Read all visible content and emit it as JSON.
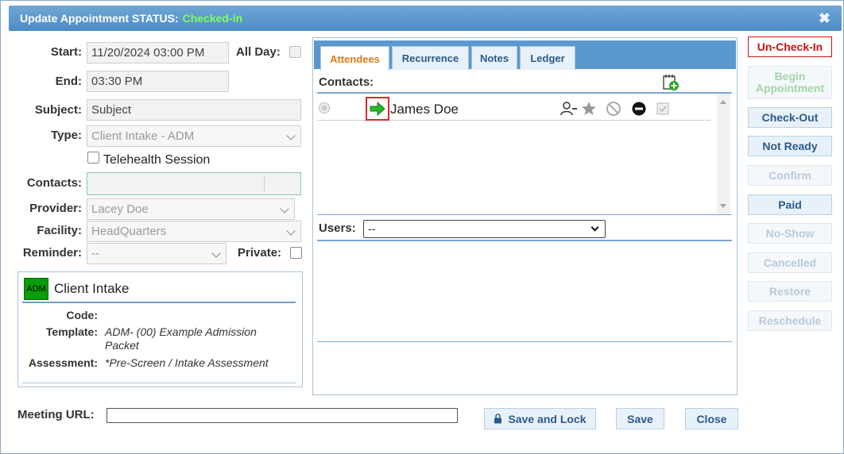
{
  "dialog": {
    "title": "Update Appointment STATUS:",
    "status": "Checked-in",
    "close_icon": "close-icon"
  },
  "form": {
    "start_label": "Start:",
    "start_value": "11/20/2024 03:00 PM",
    "all_day_label": "All Day:",
    "end_label": "End:",
    "end_value": "03:30 PM",
    "subject_label": "Subject:",
    "subject_value": "Subject",
    "type_label": "Type:",
    "type_value": "Client Intake - ADM",
    "telehealth_label": "Telehealth Session",
    "contacts_label": "Contacts:",
    "provider_label": "Provider:",
    "provider_value": "Lacey Doe",
    "facility_label": "Facility:",
    "facility_value": "HeadQuarters",
    "reminder_label": "Reminder:",
    "reminder_value": "--",
    "private_label": "Private:",
    "meeting_url_label": "Meeting URL:"
  },
  "service": {
    "badge": "ADM",
    "badge_color": "#0a9c0a",
    "title": "Client Intake",
    "code_label": "Code:",
    "code_value": "",
    "template_label": "Template:",
    "template_value_line1": "ADM- (00) Example Admission",
    "template_value_line2": "Packet",
    "assessment_label": "Assessment:",
    "assessment_value": "*Pre-Screen / Intake Assessment"
  },
  "tabs": [
    {
      "label": "Attendees",
      "active": true
    },
    {
      "label": "Recurrence",
      "active": false
    },
    {
      "label": "Notes",
      "active": false
    },
    {
      "label": "Ledger",
      "active": false
    }
  ],
  "attendees": {
    "contacts_label": "Contacts:",
    "add_contact_icon": "add-contact-icon",
    "contacts": [
      {
        "name": "James Doe",
        "status_icon": "checked-in-arrow-icon"
      }
    ],
    "users_label": "Users:",
    "users_value": "--"
  },
  "actions": {
    "un_check_in": "Un-Check-In",
    "begin_appointment": "Begin Appointment",
    "check_out": "Check-Out",
    "not_ready": "Not Ready",
    "confirm": "Confirm",
    "paid": "Paid",
    "no_show": "No-Show",
    "cancelled": "Cancelled",
    "restore": "Restore",
    "reschedule": "Reschedule"
  },
  "footer": {
    "save_and_lock": "Save and Lock",
    "save": "Save",
    "close": "Close"
  },
  "colors": {
    "title_bar": "#5b98cf",
    "status_green": "#7dff5a",
    "active_tab_text": "#e07a13",
    "danger": "#cc1111"
  }
}
